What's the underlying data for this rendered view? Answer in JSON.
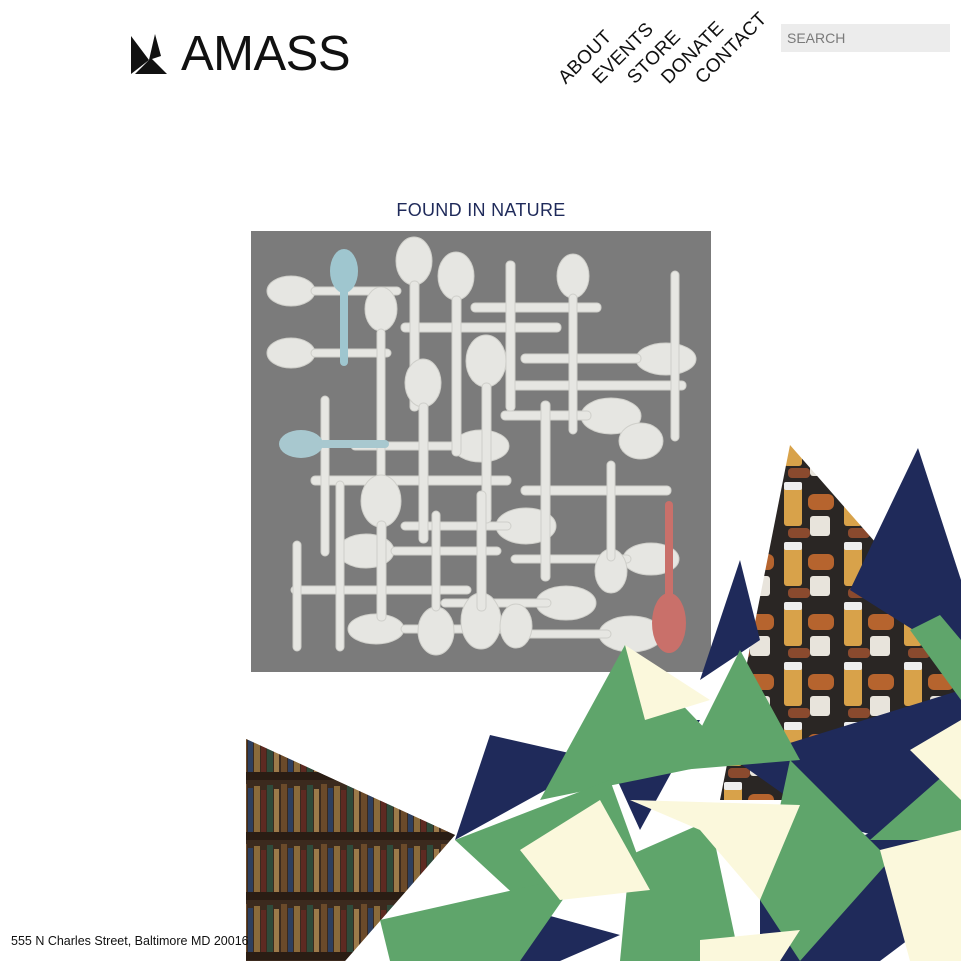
{
  "brand": {
    "name": "AMASS",
    "logo_icon": "folded-paper-crane-icon"
  },
  "nav": {
    "items": [
      {
        "label": "ABOUT"
      },
      {
        "label": "EVENTS"
      },
      {
        "label": "STORE"
      },
      {
        "label": "DONATE"
      },
      {
        "label": "CONTACT"
      }
    ]
  },
  "search": {
    "placeholder": "SEARCH"
  },
  "feature": {
    "title": "FOUND IN NATURE"
  },
  "footer": {
    "address": "555 N Charles Street, Baltimore MD 20016"
  },
  "colors": {
    "navy": "#1f2a5a",
    "green": "#5fa56b",
    "cream": "#fbf8dc",
    "image_gray": "#7d7d7d"
  }
}
